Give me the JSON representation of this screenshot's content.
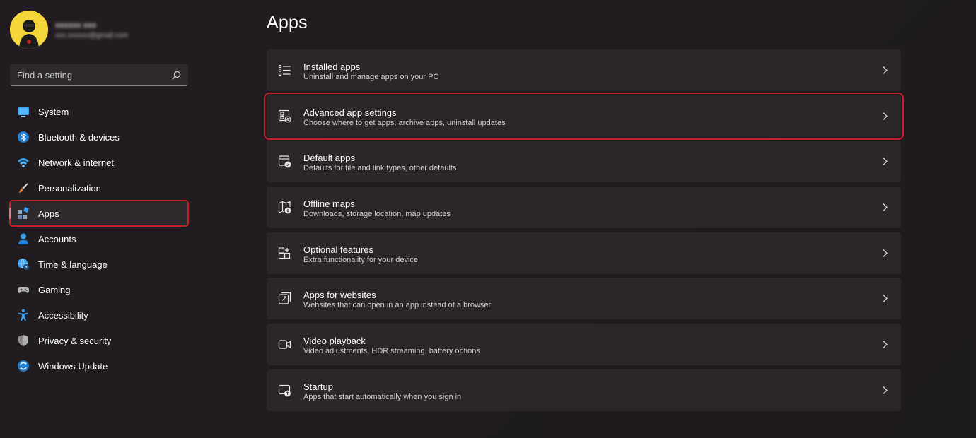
{
  "profile": {
    "name": "xxxxxx xxx",
    "email": "xxx.xxxxxx@gmail.com"
  },
  "search": {
    "placeholder": "Find a setting"
  },
  "sidebar": {
    "items": [
      {
        "label": "System",
        "icon": "system-icon"
      },
      {
        "label": "Bluetooth & devices",
        "icon": "bluetooth-icon"
      },
      {
        "label": "Network & internet",
        "icon": "wifi-icon"
      },
      {
        "label": "Personalization",
        "icon": "brush-icon"
      },
      {
        "label": "Apps",
        "icon": "apps-icon",
        "selected": true
      },
      {
        "label": "Accounts",
        "icon": "person-icon"
      },
      {
        "label": "Time & language",
        "icon": "globe-clock-icon"
      },
      {
        "label": "Gaming",
        "icon": "gamepad-icon"
      },
      {
        "label": "Accessibility",
        "icon": "accessibility-icon"
      },
      {
        "label": "Privacy & security",
        "icon": "shield-icon"
      },
      {
        "label": "Windows Update",
        "icon": "update-icon"
      }
    ]
  },
  "main": {
    "title": "Apps",
    "cards": [
      {
        "title": "Installed apps",
        "subtitle": "Uninstall and manage apps on your PC",
        "icon": "list-icon"
      },
      {
        "title": "Advanced app settings",
        "subtitle": "Choose where to get apps, archive apps, uninstall updates",
        "icon": "app-settings-icon",
        "highlighted": true
      },
      {
        "title": "Default apps",
        "subtitle": "Defaults for file and link types, other defaults",
        "icon": "default-apps-icon"
      },
      {
        "title": "Offline maps",
        "subtitle": "Downloads, storage location, map updates",
        "icon": "map-icon"
      },
      {
        "title": "Optional features",
        "subtitle": "Extra functionality for your device",
        "icon": "features-icon"
      },
      {
        "title": "Apps for websites",
        "subtitle": "Websites that can open in an app instead of a browser",
        "icon": "open-link-icon"
      },
      {
        "title": "Video playback",
        "subtitle": "Video adjustments, HDR streaming, battery options",
        "icon": "video-icon"
      },
      {
        "title": "Startup",
        "subtitle": "Apps that start automatically when you sign in",
        "icon": "startup-icon"
      }
    ]
  },
  "colors": {
    "accent": "#c4202a",
    "background": "#201b1e",
    "card": "#2b2629",
    "selected_indicator": "#e07a8c"
  }
}
